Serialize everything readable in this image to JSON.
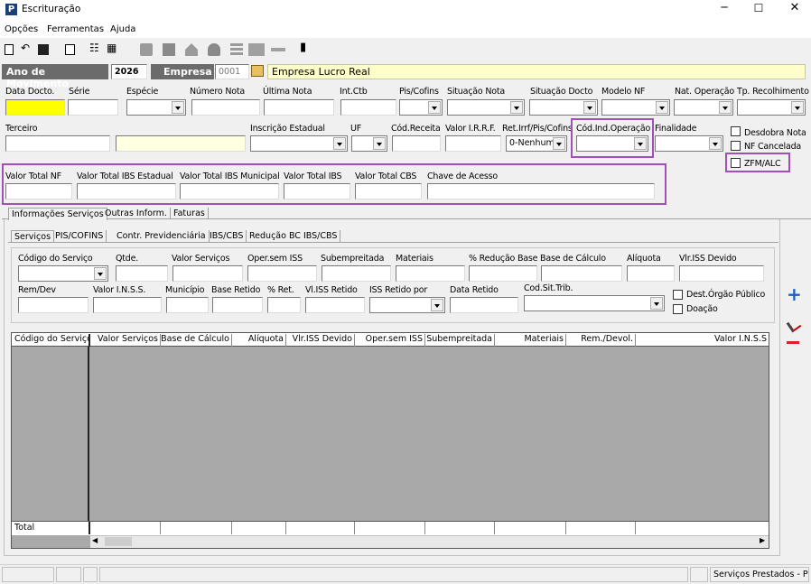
{
  "window": {
    "title": "Escrituração",
    "icon_letter": "P"
  },
  "menu": [
    "Opções",
    "Ferramentas",
    "Ajuda"
  ],
  "header": {
    "ano_label": "Ano de Movimento",
    "ano_value": "2026",
    "empresa_label": "Empresa",
    "empresa_code": "0001",
    "empresa_name": "Empresa Lucro Real"
  },
  "row1": {
    "data_docto": "Data Docto.",
    "serie": "Série",
    "especie": "Espécie",
    "numero_nota": "Número Nota",
    "ultima_nota": "Última Nota",
    "int_ctb": "Int.Ctb",
    "pis_cofins": "Pis/Cofins",
    "situacao_nota": "Situação Nota",
    "situacao_docto": "Situação Docto",
    "modelo_nf": "Modelo NF",
    "nat_operacao": "Nat. Operação",
    "tp_recolhimento": "Tp. Recolhimento"
  },
  "row2": {
    "terceiro": "Terceiro",
    "inscricao_estadual": "Inscrição Estadual",
    "uf": "UF",
    "cod_receita": "Cód.Receita",
    "valor_irrf": "Valor I.R.R.F.",
    "ret_irrf": "Ret.Irrf/Pis/Cofins",
    "ret_irrf_value": "0-Nenhum",
    "cod_ind_operacao": "Cód.Ind.Operação",
    "finalidade": "Finalidade"
  },
  "checks": {
    "desdobra": "Desdobra Nota",
    "nf_cancelada": "NF Cancelada",
    "zfm": "ZFM/ALC"
  },
  "row3": {
    "valor_total_nf": "Valor Total NF",
    "valor_total_ibs_estadual": "Valor Total IBS Estadual",
    "valor_total_ibs_municipal": "Valor Total IBS Municipal",
    "valor_total_ibs": "Valor Total IBS",
    "valor_total_cbs": "Valor Total CBS",
    "chave_acesso": "Chave de Acesso"
  },
  "tabs_main": [
    "Informações Serviços",
    "Outras Inform.",
    "Faturas"
  ],
  "tabs_sub": [
    "Serviços",
    "PIS/COFINS",
    "Contr. Previdenciária",
    "IBS/CBS",
    "Redução BC IBS/CBS"
  ],
  "services": {
    "codigo_servico": "Código do Serviço",
    "qtde": "Qtde.",
    "valor_servicos": "Valor Serviços",
    "oper_sem_iss": "Oper.sem ISS",
    "subempreitada": "Subempreitada",
    "materiais": "Materiais",
    "pct_reducao_base": "% Redução Base",
    "base_calculo": "Base de Cálculo",
    "aliquota": "Alíquota",
    "vlr_iss_devido": "Vlr.ISS Devido",
    "rem_dev": "Rem/Dev",
    "valor_inss": "Valor I.N.S.S.",
    "municipio": "Município",
    "base_retido": "Base Retido",
    "pct_ret": "% Ret.",
    "vl_iss_retido": "Vl.ISS Retido",
    "iss_retido_por": "ISS Retido por",
    "data_retido": "Data Retido",
    "cod_sit_trib": "Cod.Sit.Trib.",
    "dest_orgao_publico": "Dest.Órgão Público",
    "doacao": "Doação"
  },
  "grid": {
    "columns": [
      "Código do Serviço",
      "Valor Serviços",
      "Base de Cálculo",
      "Alíquota",
      "Vlr.ISS Devido",
      "Oper.sem ISS",
      "Subempreitada",
      "Materiais",
      "Rem./Devol.",
      "Valor I.N.S.S"
    ],
    "total_label": "Total"
  },
  "status": {
    "right": "Serviços Prestados - P"
  },
  "colors": {
    "header_dark": "#6b6b6b",
    "highlight": "#a050b8",
    "required_yellow": "#ffff00",
    "cream": "#ffffe1",
    "grid_bg": "#a9a9a9"
  }
}
